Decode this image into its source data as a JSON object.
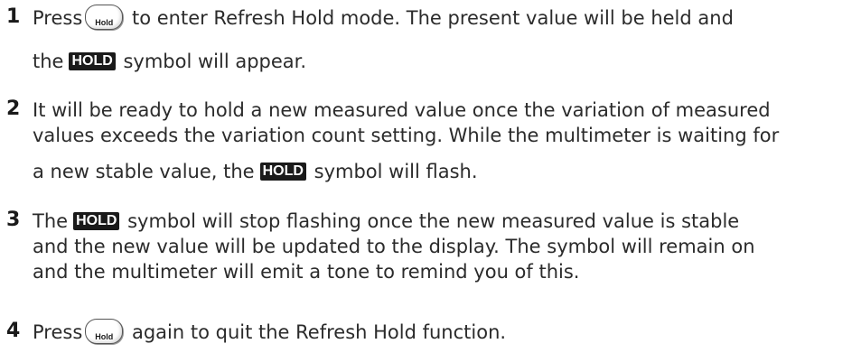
{
  "steps": [
    {
      "number": "1",
      "line1_a": "Press",
      "line1_b": "to enter Refresh Hold mode. The present value will be held and",
      "line2_a": "the",
      "line2_b": "symbol will appear."
    },
    {
      "number": "2",
      "line1": "It will be ready to hold a new measured value once the variation of measured",
      "line2": "values exceeds the variation count setting. While the multimeter is waiting for",
      "line3_a": "a new stable value, the",
      "line3_b": "symbol will flash."
    },
    {
      "number": "3",
      "line1_a": "The",
      "line1_b": "symbol will stop flashing once the new measured value is stable",
      "line2": "and the new value will be updated to the display. The symbol will remain on",
      "line3": "and the multimeter will emit a tone to remind you of this."
    },
    {
      "number": "4",
      "line1_a": "Press",
      "line1_b": "again to quit the Refresh Hold function."
    }
  ],
  "hold_button_label": "Hold",
  "hold_symbol_text": "HOLD"
}
